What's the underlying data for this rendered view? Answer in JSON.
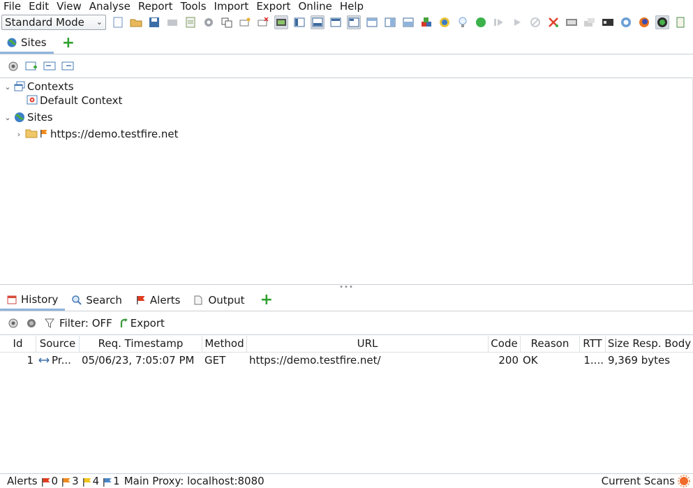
{
  "menubar": [
    "File",
    "Edit",
    "View",
    "Analyse",
    "Report",
    "Tools",
    "Import",
    "Export",
    "Online",
    "Help"
  ],
  "toolbar": {
    "mode": "Standard Mode"
  },
  "top_tabs": [
    {
      "label": "Sites"
    }
  ],
  "tree": {
    "contexts_label": "Contexts",
    "default_context_label": "Default Context",
    "sites_label": "Sites",
    "site_url": "https://demo.testfire.net"
  },
  "bottom_tabs": [
    {
      "label": "History"
    },
    {
      "label": "Search"
    },
    {
      "label": "Alerts"
    },
    {
      "label": "Output"
    }
  ],
  "history_toolbar": {
    "filter_label": "Filter: OFF",
    "export_label": "Export"
  },
  "history_table": {
    "columns": [
      "Id",
      "Source",
      "Req. Timestamp",
      "Method",
      "URL",
      "Code",
      "Reason",
      "RTT",
      "Size Resp. Body"
    ],
    "rows": [
      {
        "id": "1",
        "source": "Pr...",
        "timestamp": "05/06/23, 7:05:07 PM",
        "method": "GET",
        "url": "https://demo.testfire.net/",
        "code": "200",
        "reason": "OK",
        "rtt": "1....",
        "size": "9,369 bytes"
      }
    ]
  },
  "statusbar": {
    "alerts_label": "Alerts",
    "high": "0",
    "medium": "3",
    "low": "4",
    "info": "1",
    "proxy": "Main Proxy: localhost:8080",
    "current_scans": "Current Scans"
  },
  "colors": {
    "accent": "#8fb4db",
    "add_green": "#2fa12f",
    "flag_high": "#e03c1f",
    "flag_medium": "#f08a1c",
    "flag_low": "#f2c419",
    "flag_info": "#4a86c8"
  }
}
